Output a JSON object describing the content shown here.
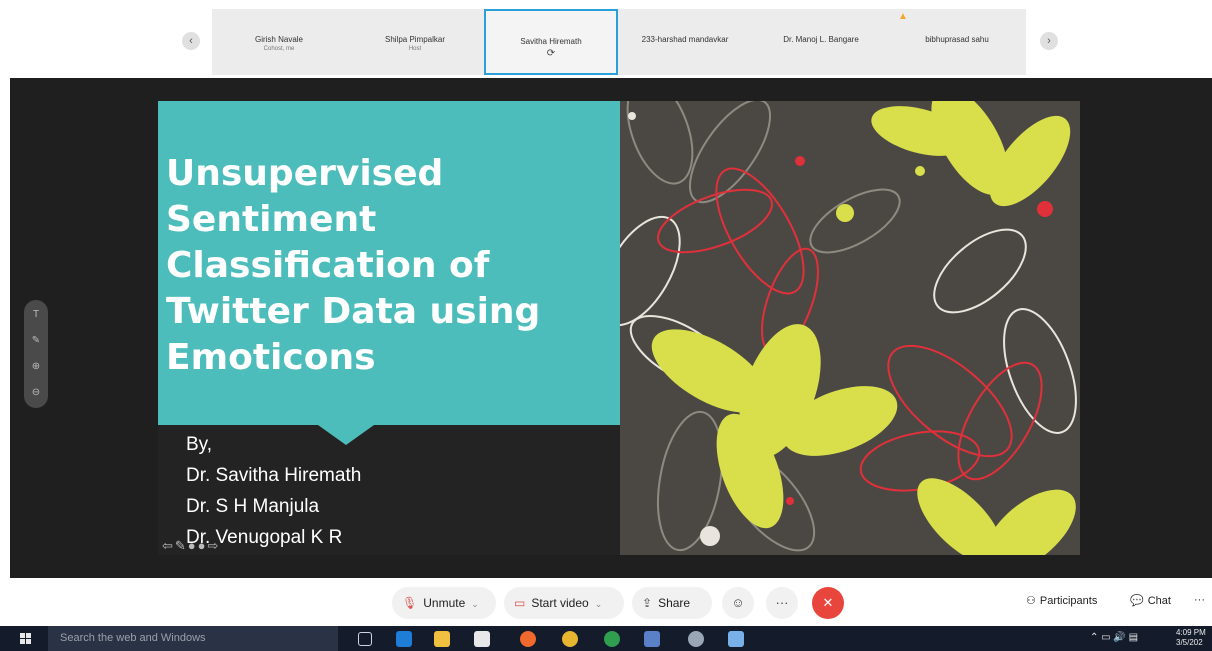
{
  "participants_strip": {
    "prev_label": "‹",
    "next_label": "›",
    "tiles": [
      {
        "name": "Girish Navale",
        "sub": "Cohost, me"
      },
      {
        "name": "Shilpa Pimpalkar",
        "sub": "Host"
      },
      {
        "name": "Savitha Hiremath",
        "sub": ""
      },
      {
        "name": "233-harshad mandavkar",
        "sub": ""
      },
      {
        "name": "Dr. Manoj L. Bangare",
        "sub": ""
      },
      {
        "name": "bibhuprasad sahu",
        "sub": ""
      }
    ],
    "active_index": 2
  },
  "slide": {
    "title": "Unsupervised Sentiment Classification of Twitter Data using Emoticons",
    "authors_intro": "By,",
    "authors": [
      "Dr. Savitha Hiremath",
      "Dr. S H Manjula",
      "Dr. Venugopal K R"
    ],
    "colors": {
      "teal": "#4dbdbb",
      "dark": "#232323",
      "flower_red": "#e0303a",
      "flower_yellow": "#d9df4a",
      "flower_white": "#e9e5dc",
      "flower_gray": "#8f8a80"
    }
  },
  "controls": {
    "unmute_label": "Unmute",
    "start_video_label": "Start video",
    "share_label": "Share",
    "more_label": "···",
    "participants_label": "Participants",
    "chat_label": "Chat",
    "overflow_label": "···"
  },
  "taskbar": {
    "search_placeholder": "Search the web and Windows",
    "time": "4:09 PM",
    "date": "3/5/202"
  }
}
